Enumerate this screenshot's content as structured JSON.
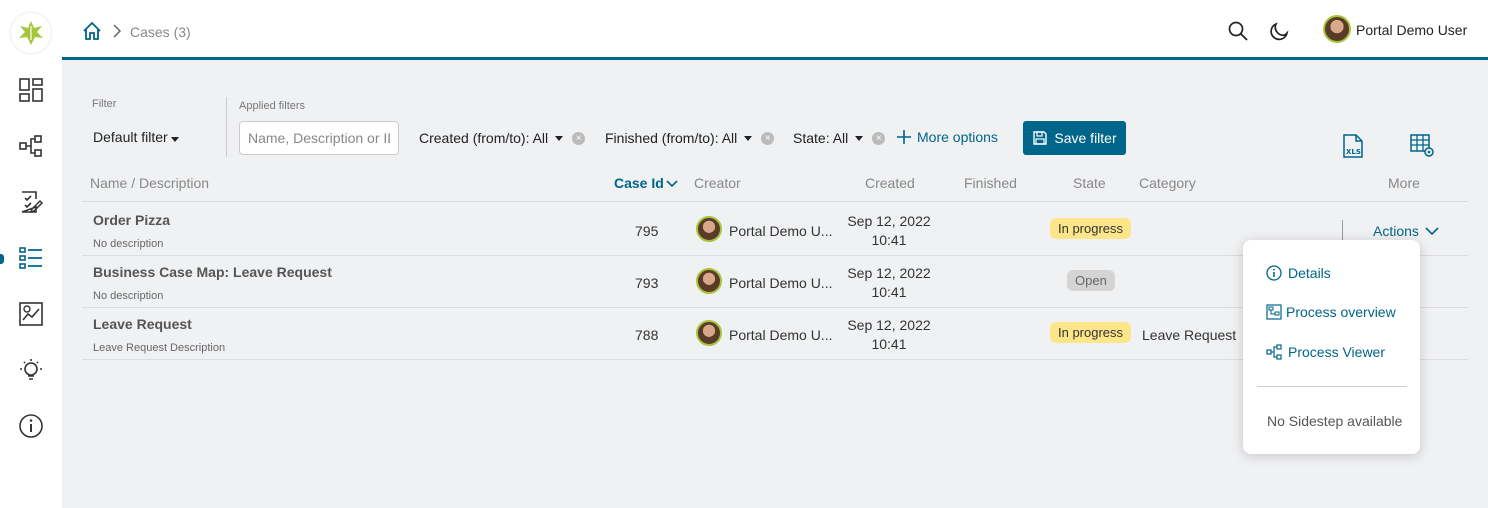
{
  "header": {
    "breadcrumb": "Cases (3)",
    "user_name": "Portal Demo User"
  },
  "filters": {
    "filter_label": "Filter",
    "default_filter": "Default filter",
    "applied_label": "Applied filters",
    "search_placeholder": "Name, Description or ID",
    "created": "Created (from/to): All",
    "finished": "Finished (from/to): All",
    "state": "State: All",
    "more_options": "More options",
    "save_filter": "Save filter"
  },
  "table": {
    "columns": {
      "name": "Name / Description",
      "case_id": "Case Id",
      "creator": "Creator",
      "created": "Created",
      "finished": "Finished",
      "state": "State",
      "category": "Category",
      "more": "More"
    },
    "rows": [
      {
        "name": "Order Pizza",
        "desc": "No description",
        "id": "795",
        "creator": "Portal Demo U...",
        "date": "Sep 12, 2022",
        "time": "10:41",
        "state": "In progress",
        "category": ""
      },
      {
        "name": "Business Case Map: Leave Request",
        "desc": "No description",
        "id": "793",
        "creator": "Portal Demo U...",
        "date": "Sep 12, 2022",
        "time": "10:41",
        "state": "Open",
        "category": ""
      },
      {
        "name": "Leave Request",
        "desc": "Leave Request Description",
        "id": "788",
        "creator": "Portal Demo U...",
        "date": "Sep 12, 2022",
        "time": "10:41",
        "state": "In progress",
        "category": "Leave Request"
      }
    ],
    "actions_label": "Actions"
  },
  "menu": {
    "details": "Details",
    "process_overview": "Process overview",
    "process_viewer": "Process Viewer",
    "no_sidestep": "No Sidestep available"
  },
  "colors": {
    "accent": "#00658a",
    "in_progress": "#fde68a",
    "open": "#d4d4d4"
  }
}
